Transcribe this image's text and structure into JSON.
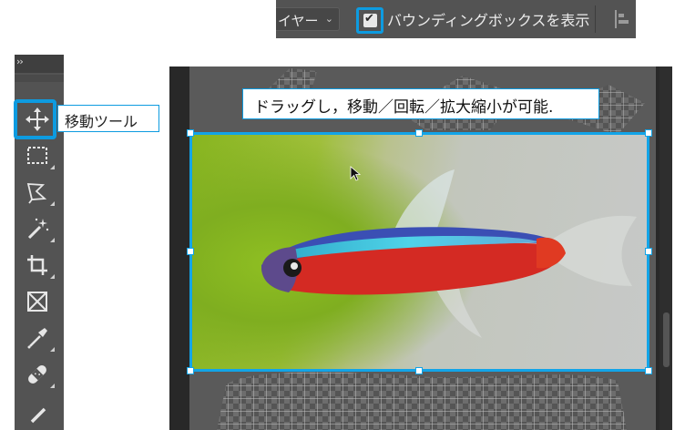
{
  "options_bar": {
    "layer_dropdown": {
      "value": "イヤー",
      "chevron_icon": "chevron-down-icon"
    },
    "bounding_box_checkbox": {
      "label": "バウンディングボックスを表示",
      "checked": true
    },
    "align_icon": "align-left-edges-icon"
  },
  "toolbar": {
    "collapse_label": "››",
    "tools": [
      {
        "name": "move-tool",
        "icon": "move-icon"
      },
      {
        "name": "rectangular-marquee-tool",
        "icon": "marquee-icon"
      },
      {
        "name": "lasso-tool",
        "icon": "lasso-icon"
      },
      {
        "name": "magic-wand-tool",
        "icon": "magic-wand-icon"
      },
      {
        "name": "crop-tool",
        "icon": "crop-icon"
      },
      {
        "name": "frame-tool",
        "icon": "frame-icon"
      },
      {
        "name": "eyedropper-tool",
        "icon": "eyedropper-icon"
      },
      {
        "name": "spot-healing-tool",
        "icon": "bandage-icon"
      },
      {
        "name": "brush-tool",
        "icon": "brush-icon"
      }
    ]
  },
  "move_tool_callout": "移動ツール",
  "canvas_callout": "ドラッグし，移動／回転／拡大縮小が可能.",
  "colors": {
    "accent": "#0d9be0",
    "panel": "#535353",
    "canvas_bg": "#282828"
  }
}
